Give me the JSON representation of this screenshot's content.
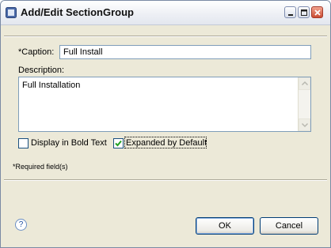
{
  "window": {
    "title": "Add/Edit SectionGroup",
    "controls": {
      "minimize": "minimize-icon",
      "maximize": "maximize-icon",
      "close": "close-icon"
    }
  },
  "form": {
    "caption_label": "*Caption:",
    "caption_value": "Full Install",
    "description_label": "Description:",
    "description_value": "Full Installation",
    "checkboxes": [
      {
        "label": "Display in Bold Text",
        "checked": false
      },
      {
        "label": "Expanded by Default",
        "checked": true
      }
    ]
  },
  "footer": {
    "required_note": "*Required field(s)",
    "help_icon": "help-icon",
    "ok_label": "OK",
    "cancel_label": "Cancel"
  },
  "colors": {
    "title_bar": "#eef0f5",
    "dialog_bg": "#ece9d8",
    "field_border": "#7f9db9",
    "check_mark": "#21a121"
  }
}
